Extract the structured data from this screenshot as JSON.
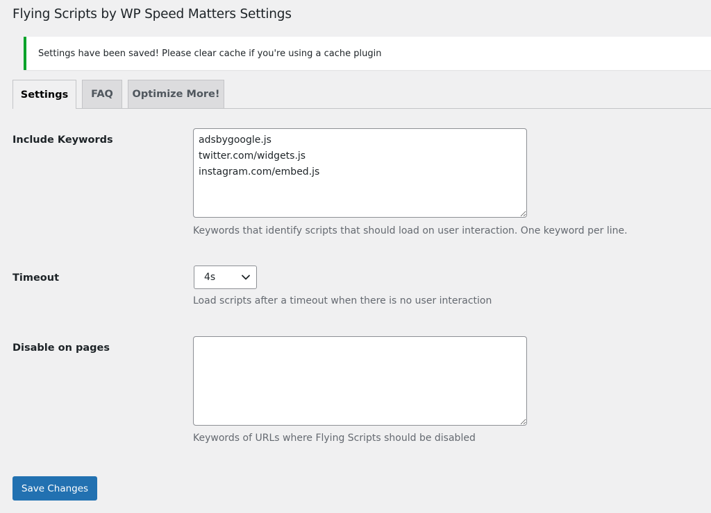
{
  "page": {
    "title": "Flying Scripts by WP Speed Matters Settings"
  },
  "notice": {
    "message": "Settings have been saved! Please clear cache if you're using a cache plugin",
    "color": "#00a32a"
  },
  "tabs": [
    {
      "label": "Settings",
      "active": true
    },
    {
      "label": "FAQ",
      "active": false
    },
    {
      "label": "Optimize More!",
      "active": false
    }
  ],
  "form": {
    "include_keywords": {
      "label": "Include Keywords",
      "value": "adsbygoogle.js\ntwitter.com/widgets.js\ninstagram.com/embed.js",
      "description": "Keywords that identify scripts that should load on user interaction. One keyword per line."
    },
    "timeout": {
      "label": "Timeout",
      "selected": "4s",
      "description": "Load scripts after a timeout when there is no user interaction"
    },
    "disable_on_pages": {
      "label": "Disable on pages",
      "value": "",
      "description": "Keywords of URLs where Flying Scripts should be disabled"
    }
  },
  "actions": {
    "save_label": "Save Changes",
    "save_color": "#2271b1"
  }
}
